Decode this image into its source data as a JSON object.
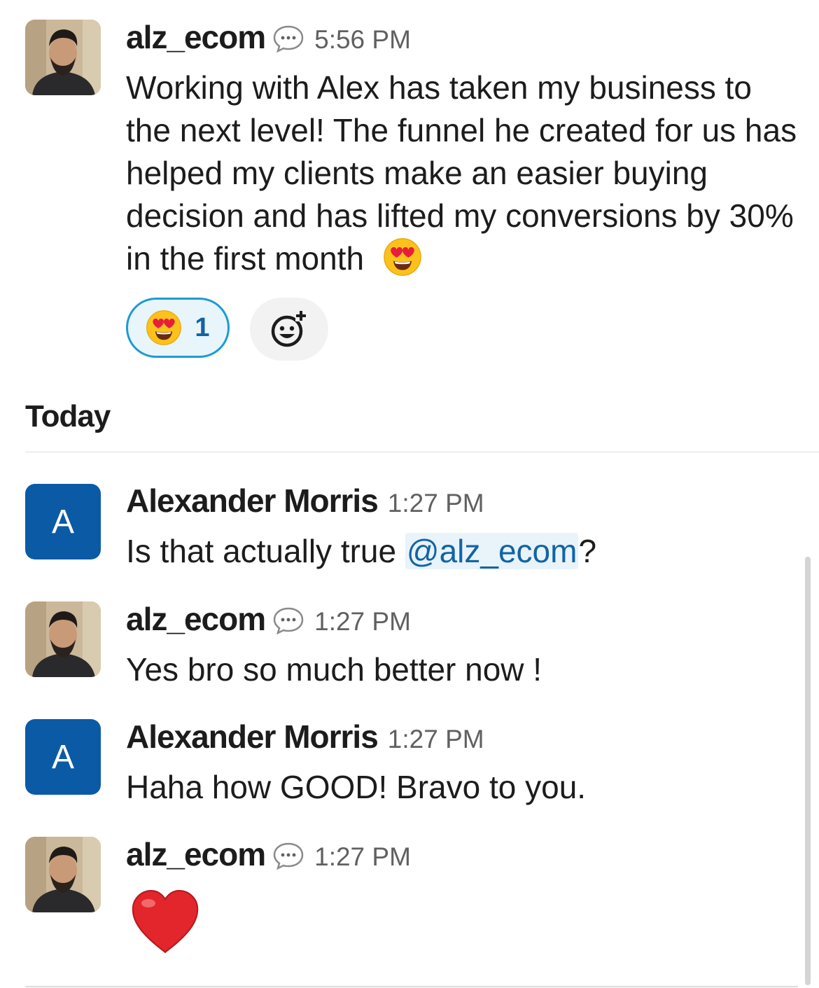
{
  "messages": [
    {
      "author": "alz_ecom",
      "time": "5:56 PM",
      "text": "Working with Alex has taken my business to the next level! The funnel he created for us has helped my clients make an easier buying decision and has lifted my conversions by 30% in the first month",
      "emoji": "heart-eyes",
      "reaction": {
        "emoji": "heart-eyes",
        "count": "1"
      }
    },
    {
      "author": "Alexander Morris",
      "avatar_letter": "A",
      "time": "1:27 PM",
      "text_before": "Is that actually true ",
      "mention": "@alz_ecom",
      "text_after": "?"
    },
    {
      "author": "alz_ecom",
      "time": "1:27 PM",
      "text": "Yes bro so much better now !"
    },
    {
      "author": "Alexander Morris",
      "avatar_letter": "A",
      "time": "1:27 PM",
      "text": "Haha how GOOD! Bravo to you."
    },
    {
      "author": "alz_ecom",
      "time": "1:27 PM",
      "emoji": "red-heart"
    }
  ],
  "day_divider": "Today",
  "colors": {
    "mention": "#1264a3",
    "reaction_border": "#1d9bd1",
    "avatar_letter_bg": "#0b5aa6"
  }
}
